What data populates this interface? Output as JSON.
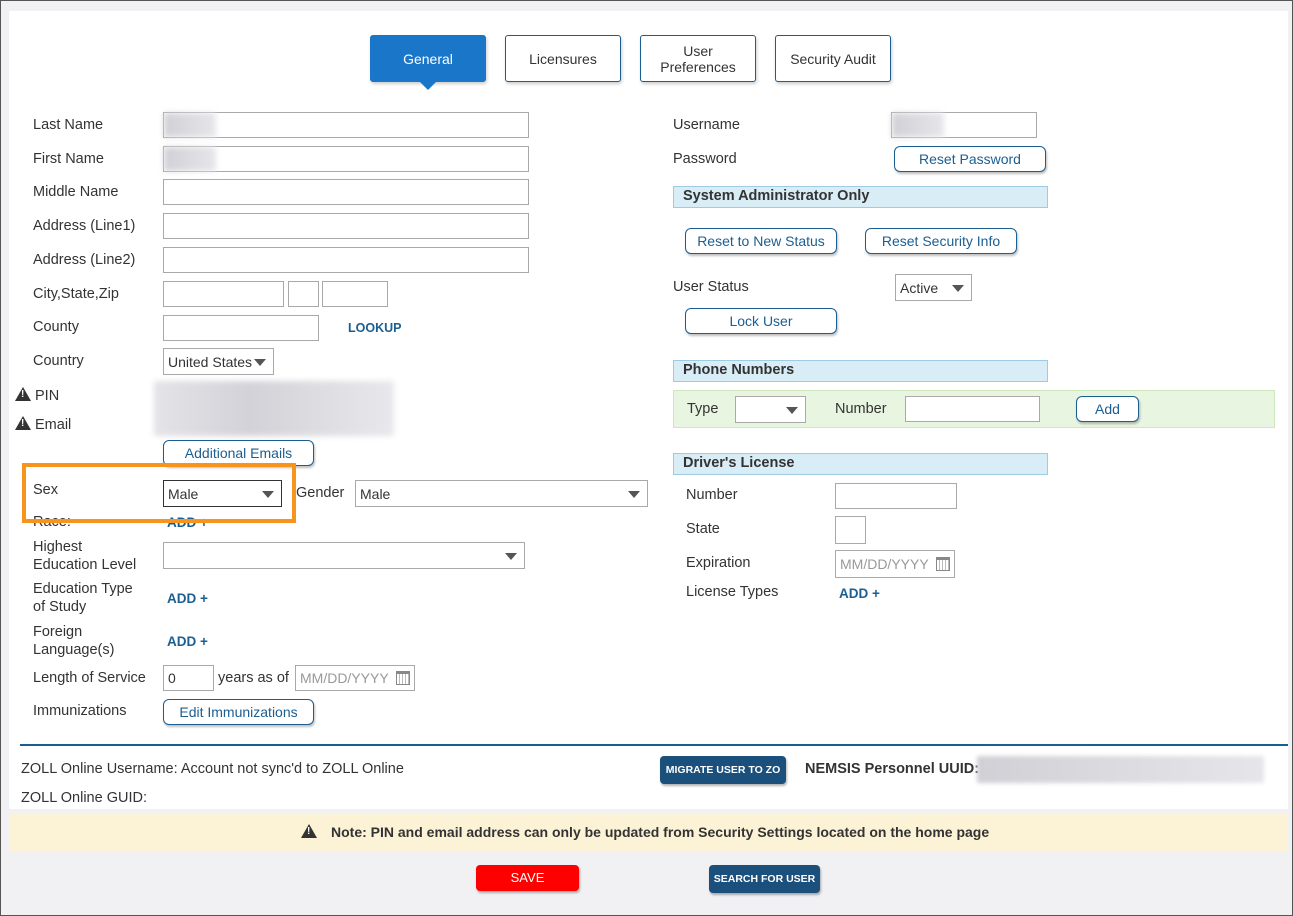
{
  "tabs": [
    {
      "label": "General",
      "active": true
    },
    {
      "label": "Licensures"
    },
    {
      "label": "User Preferences"
    },
    {
      "label": "Security Audit"
    }
  ],
  "left": {
    "last_name": "Last Name",
    "first_name": "First Name",
    "middle_name": "Middle Name",
    "address1": "Address (Line1)",
    "address2": "Address (Line2)",
    "city_state_zip": "City,State,Zip",
    "county": "County",
    "lookup": "LOOKUP",
    "country": "Country",
    "country_value": "United States",
    "pin": "PIN",
    "email": "Email",
    "additional_emails": "Additional Emails",
    "sex": "Sex",
    "sex_value": "Male",
    "gender": "Gender",
    "gender_value": "Male",
    "race": "Race:",
    "add": "ADD +",
    "education_level": [
      "Highest",
      "Education Level"
    ],
    "education_type": [
      "Education Type",
      "of Study"
    ],
    "foreign_language": [
      "Foreign",
      "Language(s)"
    ],
    "length_of_service": "Length of Service",
    "length_value": "0",
    "years_as_of": "years as of",
    "date_placeholder": "MM/DD/YYYY",
    "immunizations": "Immunizations",
    "edit_immunizations": "Edit Immunizations"
  },
  "right": {
    "username": "Username",
    "password": "Password",
    "reset_password": "Reset Password",
    "sysadmin_header": "System Administrator Only",
    "reset_new_status": "Reset to New Status",
    "reset_security_info": "Reset Security Info",
    "user_status": "User Status",
    "user_status_value": "Active",
    "lock_user": "Lock User",
    "phone_header": "Phone Numbers",
    "phone_type": "Type",
    "phone_number": "Number",
    "phone_add": "Add",
    "dl_header": "Driver's License",
    "dl_number": "Number",
    "dl_state": "State",
    "dl_expiration": "Expiration",
    "dl_license_types": "License Types",
    "date_placeholder": "MM/DD/YYYY",
    "add": "ADD +"
  },
  "footer": {
    "zoll_username": "ZOLL Online Username: Account not sync'd to ZOLL Online",
    "zoll_guid": "ZOLL Online GUID:",
    "migrate": "MIGRATE USER TO ZO",
    "nemsis_uuid": "NEMSIS Personnel UUID:",
    "note": "Note: PIN and email address can only be updated from Security Settings located on the home page",
    "save": "SAVE",
    "search": "SEARCH FOR USER"
  },
  "colors": {
    "primary": "#1976c8",
    "dark_button": "#1b4f7c",
    "save": "#ff0000",
    "highlight": "#f7941d",
    "note_bg": "#fcf3d6"
  }
}
